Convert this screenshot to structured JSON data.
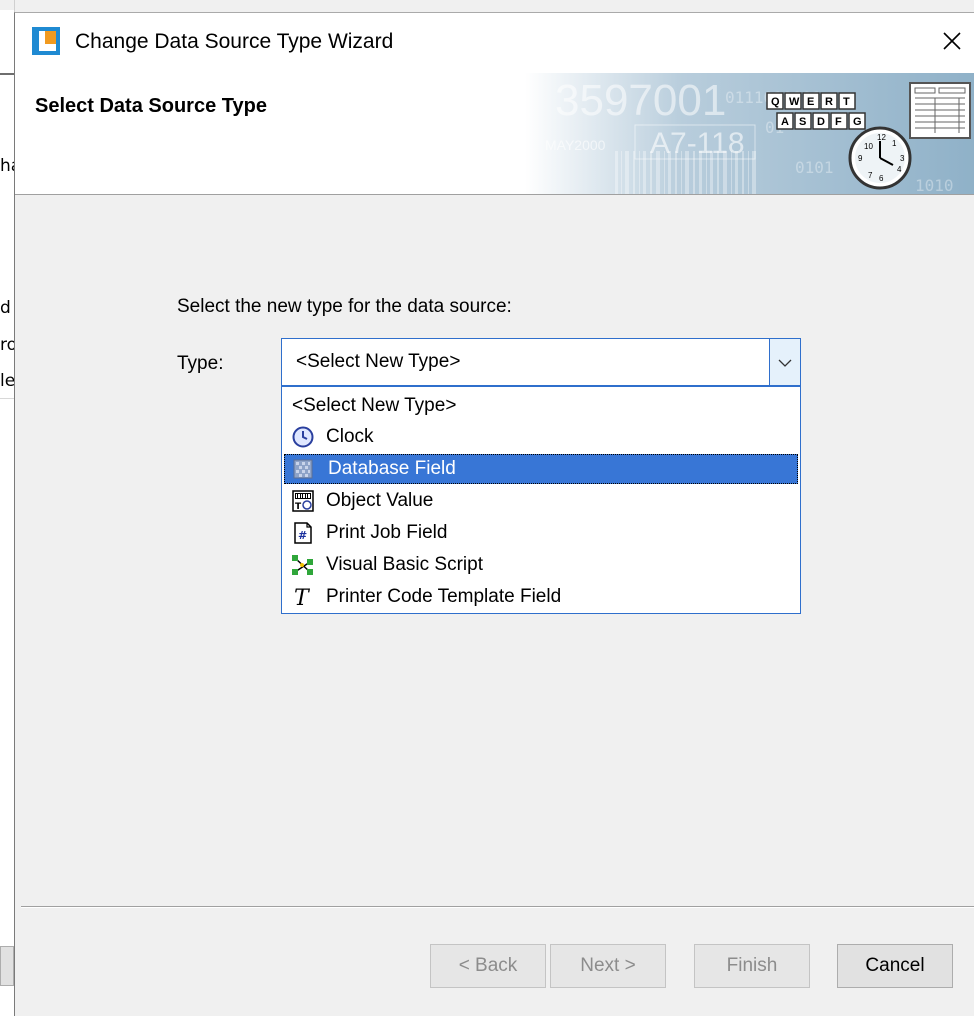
{
  "background_window": {
    "fragments": [
      "ha",
      "d",
      "ro",
      "le"
    ]
  },
  "window": {
    "title": "Change Data Source Type Wizard",
    "close_glyph": "✕"
  },
  "header": {
    "title": "Select Data Source Type",
    "art_numbers": [
      "3597001",
      "A7-118",
      "MAY2000"
    ],
    "keyboard_keys_row1": [
      "Q",
      "W",
      "E",
      "R",
      "T"
    ],
    "keyboard_keys_row2": [
      "A",
      "S",
      "D",
      "F",
      "G"
    ]
  },
  "form": {
    "prompt": "Select the new type for the data source:",
    "type_label": "Type:",
    "selected_value": "<Select New Type>"
  },
  "dropdown": {
    "options": [
      {
        "label": "<Select New Type>",
        "icon": "none"
      },
      {
        "label": "Clock",
        "icon": "clock-icon"
      },
      {
        "label": "Database Field",
        "icon": "database-icon",
        "highlighted": true
      },
      {
        "label": "Object Value",
        "icon": "object-value-icon"
      },
      {
        "label": "Print Job Field",
        "icon": "print-job-icon"
      },
      {
        "label": "Visual Basic Script",
        "icon": "script-icon"
      },
      {
        "label": "Printer Code Template Field",
        "icon": "template-icon"
      }
    ]
  },
  "buttons": {
    "back": "< Back",
    "next": "Next >",
    "finish": "Finish",
    "cancel": "Cancel"
  },
  "colors": {
    "accent": "#3876d6",
    "combo_border": "#2f6fcc",
    "dialog_bg": "#f0f0f0"
  }
}
